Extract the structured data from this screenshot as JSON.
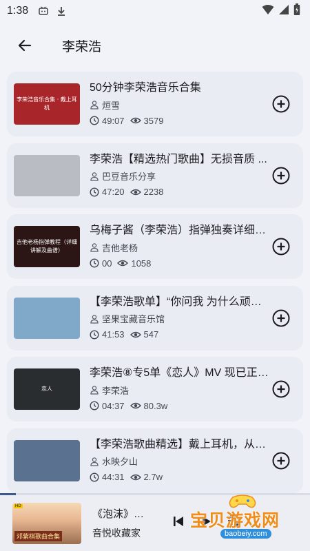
{
  "status_bar": {
    "time": "1:38"
  },
  "header": {
    "title": "李荣浩"
  },
  "items": [
    {
      "title": "50分钟李荣浩音乐合集",
      "author": "烜雪",
      "duration": "49:07",
      "views": "3579",
      "thumb_text": "李荣浩音乐合集 · 戴上耳机",
      "thumb_bg": "#a8262a"
    },
    {
      "title": "李荣浩【精选热门歌曲】无损音质 ...",
      "author": "巴豆音乐分享",
      "duration": "47:20",
      "views": "2238",
      "thumb_text": "",
      "thumb_bg": "#b9bcc2"
    },
    {
      "title": "乌梅子酱（李荣浩）指弹独奏详细…",
      "author": "吉他老杨",
      "duration": "00",
      "views": "1058",
      "thumb_text": "吉他老杨指弹教程（详细讲解及曲谱）",
      "thumb_bg": "#2b1515"
    },
    {
      "title": "【李荣浩歌单】“你问我 为什么顽固…",
      "author": "坚果宝藏音乐馆",
      "duration": "41:53",
      "views": "547",
      "thumb_text": "",
      "thumb_bg": "#7fa8c9"
    },
    {
      "title": "李荣浩⑧专5单《恋人》MV 现已正…",
      "author": "李荣浩",
      "duration": "04:37",
      "views": "80.3w",
      "thumb_text": "恋人",
      "thumb_bg": "#2a2d30"
    },
    {
      "title": "【李荣浩歌曲精选】戴上耳机，从…",
      "author": "水映夕山",
      "duration": "44:31",
      "views": "2.7w",
      "thumb_text": "",
      "thumb_bg": "#5a7190"
    }
  ],
  "player": {
    "song": "《泡沫》…",
    "artist": "音悦收藏家",
    "cover_caption": "邓紫棋歌曲合集",
    "cover_tag": "HD",
    "progress": 0.05
  },
  "watermark": {
    "text": "宝贝游戏网",
    "url": "baobeiy.com"
  },
  "colors": {
    "background": "#f1f3f8",
    "card": "#e9ecf3",
    "accent": "#3c5a8c",
    "watermark": "#f08c1a"
  }
}
